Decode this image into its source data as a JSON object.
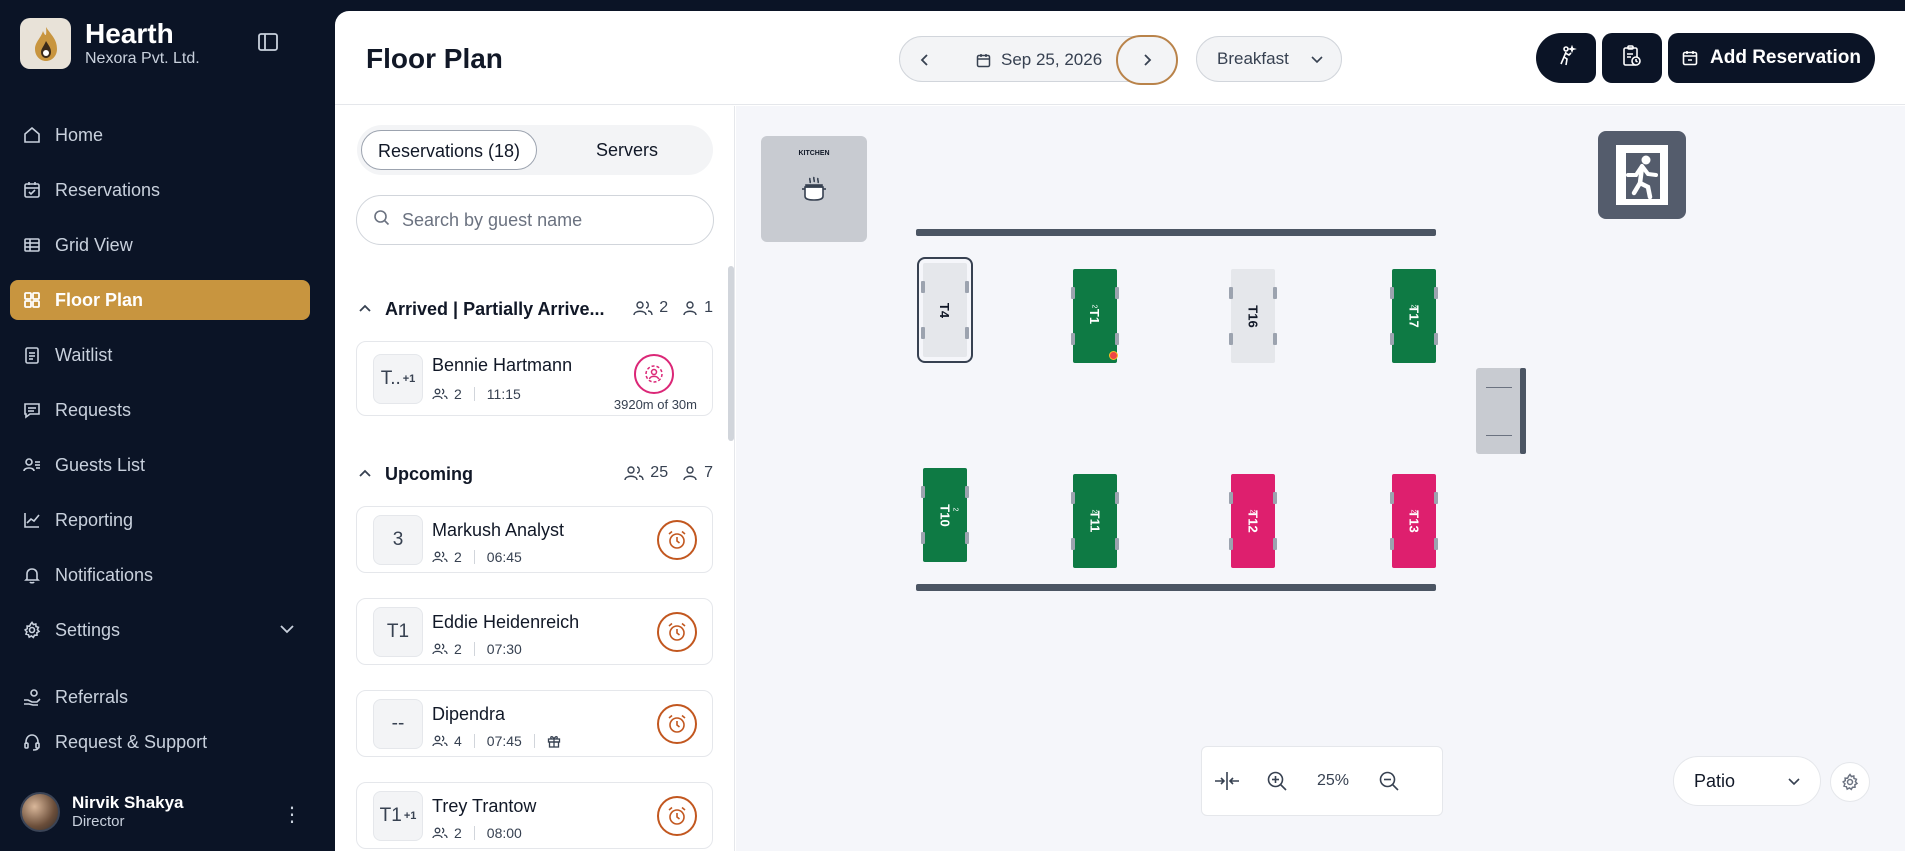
{
  "brand": {
    "name": "Hearth",
    "company": "Nexora Pvt. Ltd."
  },
  "nav": {
    "items": [
      {
        "label": "Home",
        "icon": "home-icon"
      },
      {
        "label": "Reservations",
        "icon": "calendar-check-icon"
      },
      {
        "label": "Grid View",
        "icon": "grid-table-icon"
      },
      {
        "label": "Floor Plan",
        "icon": "layout-grid-icon",
        "active": true
      },
      {
        "label": "Waitlist",
        "icon": "clipboard-list-icon"
      },
      {
        "label": "Requests",
        "icon": "message-square-icon"
      },
      {
        "label": "Guests List",
        "icon": "users-list-icon"
      },
      {
        "label": "Reporting",
        "icon": "line-chart-icon"
      },
      {
        "label": "Notifications",
        "icon": "bell-icon"
      },
      {
        "label": "Settings",
        "icon": "gear-icon"
      }
    ],
    "bottom": [
      {
        "label": "Referrals",
        "icon": "hand-coins-icon"
      },
      {
        "label": "Request & Support",
        "icon": "headset-icon"
      }
    ]
  },
  "user": {
    "name": "Nirvik Shakya",
    "role": "Director"
  },
  "header": {
    "title": "Floor Plan",
    "date": "Sep 25, 2026",
    "meal": "Breakfast",
    "add_label": "Add Reservation"
  },
  "panel": {
    "tab_reservations": "Reservations (18)",
    "tab_servers": "Servers",
    "search_placeholder": "Search by guest name",
    "groups": [
      {
        "title": "Arrived | Partially Arrive...",
        "covers": "2",
        "guests": "1",
        "items": [
          {
            "badge": "T..",
            "extra": "+1",
            "name": "Bennie Hartmann",
            "party": "2",
            "time": "11:15",
            "elapsed": "3920m of 30m"
          }
        ]
      },
      {
        "title": "Upcoming",
        "covers": "25",
        "guests": "7",
        "items": [
          {
            "badge": "3",
            "name": "Markush Analyst",
            "party": "2",
            "time": "06:45"
          },
          {
            "badge": "T1",
            "name": "Eddie Heidenreich",
            "party": "2",
            "time": "07:30"
          },
          {
            "badge": "--",
            "name": "Dipendra",
            "party": "4",
            "time": "07:45"
          },
          {
            "badge": "T1",
            "extra": "+1",
            "name": "Trey Trantow",
            "party": "2",
            "time": "08:00"
          }
        ]
      }
    ]
  },
  "floor": {
    "kitchen_label": "KITCHEN",
    "zoom": "25%",
    "area": "Patio",
    "tables": [
      {
        "label": "T4",
        "status": "grey",
        "selected": true
      },
      {
        "label": "T1",
        "status": "green",
        "capacity": "2"
      },
      {
        "label": "T16",
        "status": "grey"
      },
      {
        "label": "T17",
        "status": "green",
        "capacity": "2"
      },
      {
        "label": "T10",
        "status": "green",
        "capacity": "2"
      },
      {
        "label": "T11",
        "status": "green",
        "capacity": "2"
      },
      {
        "label": "T12",
        "status": "pink",
        "capacity": "2"
      },
      {
        "label": "T13",
        "status": "pink",
        "capacity": "2"
      }
    ]
  },
  "colors": {
    "sidebar_bg": "#0b1426",
    "accent": "#c8953f",
    "available": "#0e7a44",
    "seated": "#de1f6e",
    "alarm": "#c2571f"
  }
}
